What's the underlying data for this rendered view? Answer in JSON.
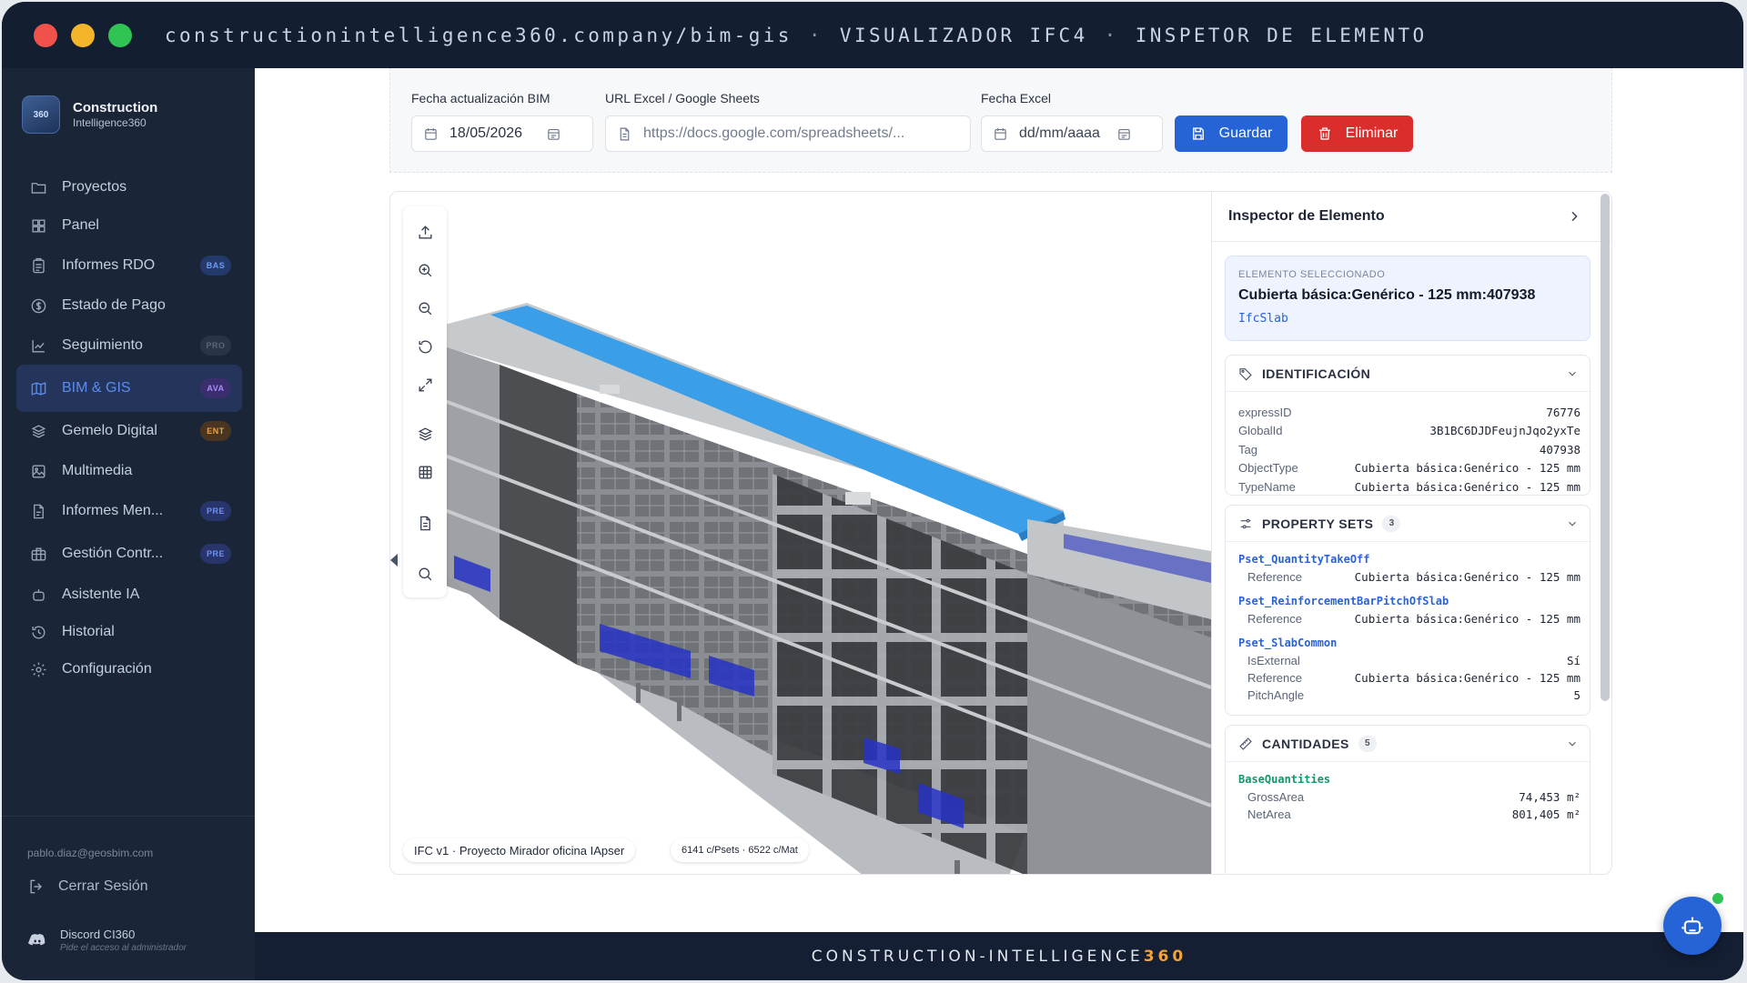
{
  "browser": {
    "url": "constructionintelligence360.company/bim-gis",
    "sep": "·",
    "crumb1": "VISUALIZADOR IFC4",
    "crumb2": "INSPETOR DE ELEMENTO"
  },
  "brand": {
    "name": "Construction",
    "sub": "Intelligence360",
    "logo_text": "360"
  },
  "sidebar": {
    "items": [
      {
        "label": "Proyectos",
        "icon": "folder-icon",
        "badge": ""
      },
      {
        "label": "Panel",
        "icon": "grid-icon",
        "badge": ""
      },
      {
        "label": "Informes RDO",
        "icon": "clipboard-icon",
        "badge": "BAS"
      },
      {
        "label": "Estado de Pago",
        "icon": "dollar-icon",
        "badge": ""
      },
      {
        "label": "Seguimiento",
        "icon": "chart-line-icon",
        "badge": "PRO"
      },
      {
        "label": "BIM & GIS",
        "icon": "map-icon",
        "badge": "AVA"
      },
      {
        "label": "Gemelo Digital",
        "icon": "layers-icon",
        "badge": "ENT"
      },
      {
        "label": "Multimedia",
        "icon": "image-icon",
        "badge": ""
      },
      {
        "label": "Informes Men...",
        "icon": "file-icon",
        "badge": "PRE"
      },
      {
        "label": "Gestión Contr...",
        "icon": "briefcase-icon",
        "badge": "PRE"
      },
      {
        "label": "Asistente IA",
        "icon": "bot-icon",
        "badge": ""
      },
      {
        "label": "Historial",
        "icon": "history-icon",
        "badge": ""
      },
      {
        "label": "Configuración",
        "icon": "gear-icon",
        "badge": ""
      }
    ],
    "active_index": 5,
    "email": "pablo.diaz@geosbim.com",
    "logout": "Cerrar Sesión",
    "discord_title": "Discord CI360",
    "discord_sub": "Pide el acceso al administrador"
  },
  "form": {
    "bim_date_label": "Fecha actualización BIM",
    "bim_date_value": "18/05/2026",
    "excel_url_label": "URL Excel / Google Sheets",
    "excel_url_placeholder": "https://docs.google.com/spreadsheets/...",
    "excel_date_label": "Fecha Excel",
    "excel_date_placeholder": "dd/mm/aaaa",
    "save": "Guardar",
    "delete": "Eliminar"
  },
  "viewer": {
    "tools": [
      "upload-icon",
      "zoom-in-icon",
      "zoom-out-icon",
      "reset-icon",
      "fullscreen-icon",
      "layers-icon",
      "grid-icon",
      "document-icon",
      "search-icon"
    ],
    "model_label": "IFC v1 · Proyecto Mirador oficina IApser",
    "stats_label": "6141 c/Psets · 6522 c/Mat"
  },
  "inspector": {
    "title": "Inspector de Elemento",
    "selected_label": "ELEMENTO SELECCIONADO",
    "selected_name": "Cubierta básica:Genérico - 125 mm:407938",
    "selected_type": "IfcSlab",
    "identification": {
      "title": "IDENTIFICACIÓN",
      "rows": [
        {
          "k": "expressID",
          "v": "76776"
        },
        {
          "k": "GlobalId",
          "v": "3B1BC6DJDFeujnJqo2yxTe"
        },
        {
          "k": "Tag",
          "v": "407938"
        },
        {
          "k": "ObjectType",
          "v": "Cubierta básica:Genérico - 125 mm"
        },
        {
          "k": "TypeName",
          "v": "Cubierta básica:Genérico - 125 mm"
        }
      ]
    },
    "property_sets": {
      "title": "PROPERTY SETS",
      "count": "3",
      "sets": [
        {
          "name": "Pset_QuantityTakeOff",
          "rows": [
            {
              "k": "Reference",
              "v": "Cubierta básica:Genérico - 125 mm"
            }
          ]
        },
        {
          "name": "Pset_ReinforcementBarPitchOfSlab",
          "rows": [
            {
              "k": "Reference",
              "v": "Cubierta básica:Genérico - 125 mm"
            }
          ]
        },
        {
          "name": "Pset_SlabCommon",
          "rows": [
            {
              "k": "IsExternal",
              "v": "Sí"
            },
            {
              "k": "Reference",
              "v": "Cubierta básica:Genérico - 125 mm"
            },
            {
              "k": "PitchAngle",
              "v": "5"
            }
          ]
        }
      ]
    },
    "quantities": {
      "title": "CANTIDADES",
      "count": "5",
      "group": "BaseQuantities",
      "rows": [
        {
          "k": "GrossArea",
          "v": "74,453 m²"
        },
        {
          "k": "NetArea",
          "v": "801,405 m²"
        }
      ]
    }
  },
  "footer": {
    "text": "CONSTRUCTION-INTELLIGENCE",
    "accent": "360"
  },
  "colors": {
    "primary": "#2563d6",
    "danger": "#dc2d2d",
    "roof_highlight": "#3a9ee8",
    "sidebar_bg": "#1b2538"
  }
}
